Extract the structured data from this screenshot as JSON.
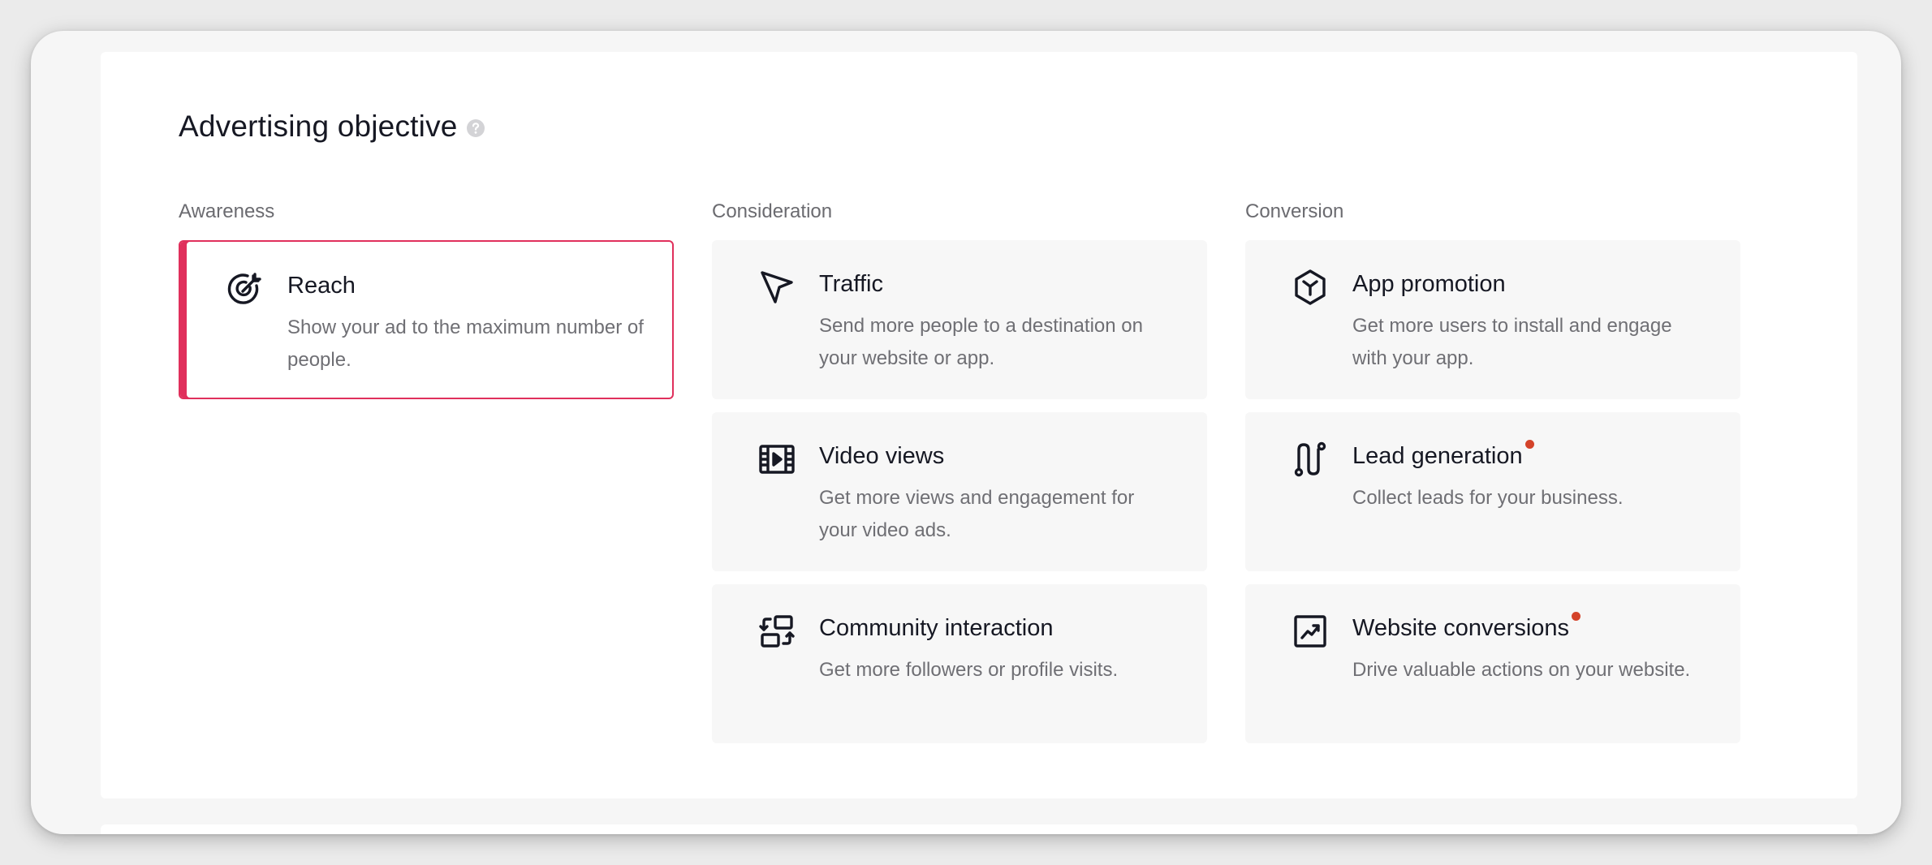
{
  "header": {
    "title": "Advertising objective",
    "help_icon": "question-circle-icon"
  },
  "colors": {
    "accent": "#e0305c",
    "new_dot": "#d4432a",
    "card_bg": "#f7f7f7"
  },
  "columns": [
    {
      "label": "Awareness",
      "cards": [
        {
          "icon": "target-icon",
          "title": "Reach",
          "description": "Show your ad to the maximum number of people.",
          "selected": true,
          "new": false
        }
      ]
    },
    {
      "label": "Consideration",
      "cards": [
        {
          "icon": "cursor-arrow-icon",
          "title": "Traffic",
          "description": "Send more people to a destination on your website or app.",
          "selected": false,
          "new": false
        },
        {
          "icon": "film-play-icon",
          "title": "Video views",
          "description": "Get more views and engagement for your video ads.",
          "selected": false,
          "new": false
        },
        {
          "icon": "community-swap-icon",
          "title": "Community interaction",
          "description": "Get more followers or profile visits.",
          "selected": false,
          "new": false
        }
      ]
    },
    {
      "label": "Conversion",
      "cards": [
        {
          "icon": "app-cube-icon",
          "title": "App promotion",
          "description": "Get more users to install and engage with your app.",
          "selected": false,
          "new": false
        },
        {
          "icon": "lead-funnel-icon",
          "title": "Lead generation",
          "description": "Collect leads for your business.",
          "selected": false,
          "new": true
        },
        {
          "icon": "trending-chart-icon",
          "title": "Website conversions",
          "description": "Drive valuable actions on your website.",
          "selected": false,
          "new": true
        }
      ]
    }
  ]
}
